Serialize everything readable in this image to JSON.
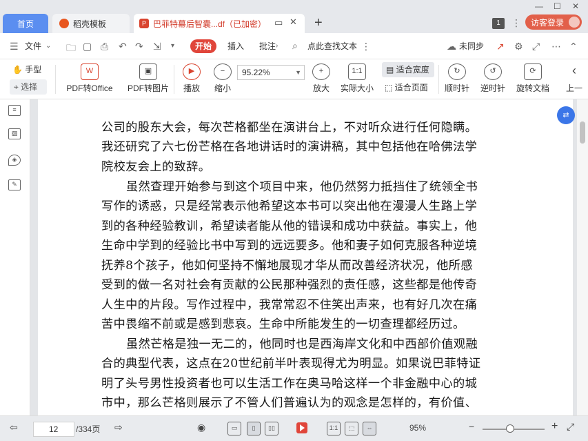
{
  "tabs": {
    "home": "首页",
    "template": "稻壳模板",
    "document": "巴菲特幕后智囊...df（已加密）"
  },
  "window": {
    "page_badge": "1",
    "login": "访客登录"
  },
  "menu": {
    "file": "文件",
    "start": "开始",
    "insert": "插入",
    "annotate": "批注",
    "search": "点此查找文本",
    "sync": "未同步"
  },
  "toolbar": {
    "hand": "手型",
    "select": "选择",
    "pdf_to_office": "PDF转Office",
    "pdf_to_image": "PDF转图片",
    "play": "播放",
    "zoom_out": "缩小",
    "zoom_value": "95.22%",
    "zoom_in": "放大",
    "actual_size": "实际大小",
    "fit_width": "适合宽度",
    "fit_page": "适合页面",
    "rotate_cw": "顺时针",
    "rotate_ccw": "逆时针",
    "rotate_doc": "旋转文档",
    "prev": "上一"
  },
  "document": {
    "paragraphs": [
      "公司的股东大会，每次芒格都坐在演讲台上，不对听众进行任何隐瞒。",
      "我还研究了六七份芒格在各地讲话时的演讲稿，其中包括他在哈佛法学",
      "院校友会上的致辞。",
      "虽然查理开始参与到这个项目中来，他仍然努力抵挡住了统领全书",
      "写作的诱惑，只是经常表示他希望这本书可以突出他在漫漫人生路上学",
      "到的各种经验教训，希望读者能从他的错误和成功中获益。事实上，他",
      "生命中学到的经验比书中写到的远远要多。他和妻子如何克服各种逆境",
      "抚养8个孩子，他如何坚持不懈地展现才华从而改善经济状况，他所感",
      "受到的做一名对社会有贡献的公民那种强烈的责任感，这些都是他传奇",
      "人生中的片段。写作过程中，我常常忍不住笑出声来，也有好几次在痛",
      "苦中畏缩不前或是感到悲哀。生命中所能发生的一切查理都经历过。",
      "虽然芒格是独一无二的，他同时也是西海岸文化和中西部价值观融",
      "合的典型代表，这点在20世纪前半叶表现得尤为明显。如果说巴菲特证",
      "明了头号男性投资者也可以生活工作在奥马哈这样一个非金融中心的城",
      "市中，那么芒格则展示了不管人们普遍认为的观念是怎样的，有价值、"
    ]
  },
  "status": {
    "current_page": "12",
    "total_pages": "/334页",
    "zoom": "95%"
  },
  "colors": {
    "accent_red": "#e0453a",
    "tab_blue": "#5b8ef0"
  }
}
